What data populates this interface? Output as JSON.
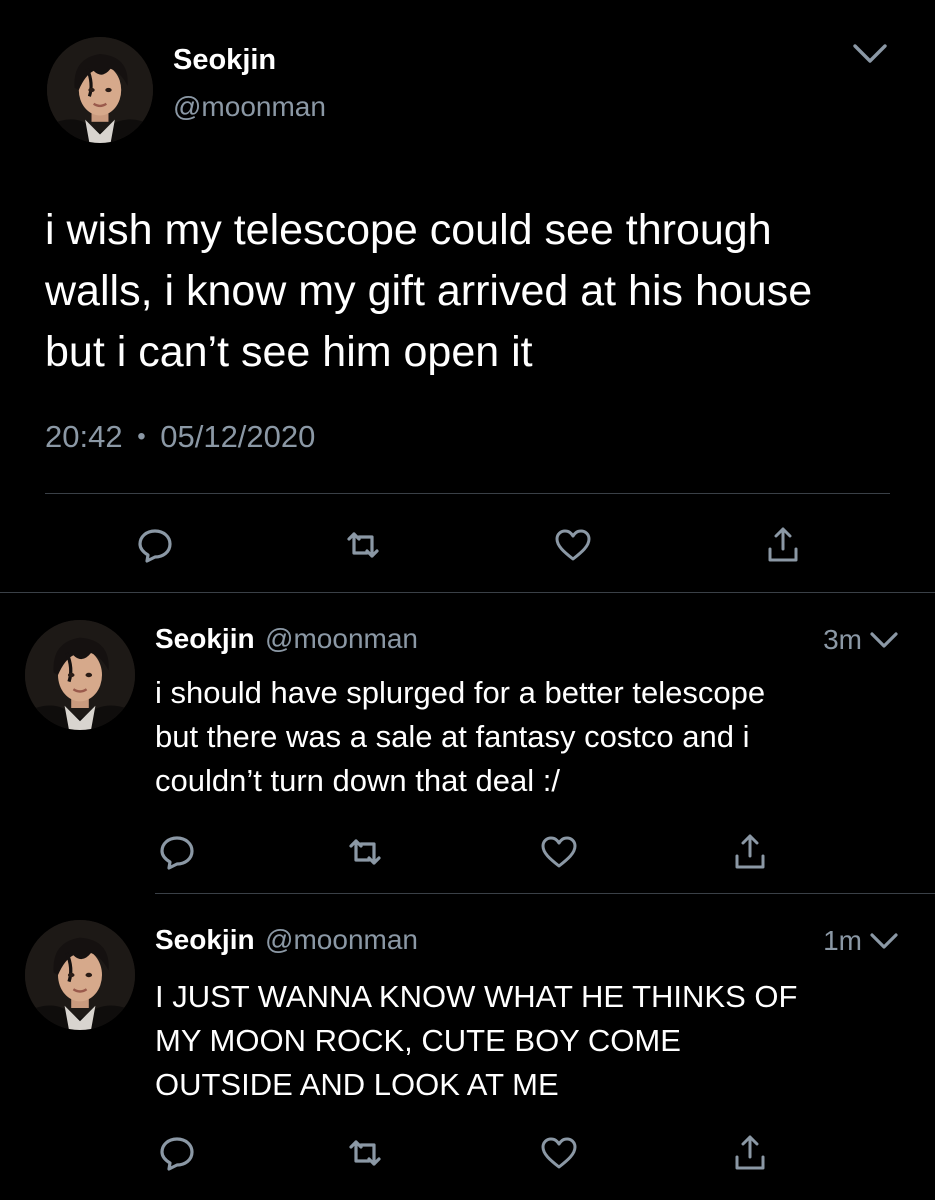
{
  "main_tweet": {
    "display_name": "Seokjin",
    "handle": "@moonman",
    "text_lines": [
      "i wish my telescope could see through",
      "walls, i know my gift arrived at his house",
      "but i can’t see him open it"
    ],
    "time": "20:42",
    "separator": "•",
    "date": "05/12/2020"
  },
  "replies": [
    {
      "display_name": "Seokjin",
      "handle": "@moonman",
      "age": "3m",
      "text_lines": [
        "i should have splurged for a better telescope",
        "but there was a sale at fantasy costco and i",
        "couldn’t turn down that deal :/"
      ]
    },
    {
      "display_name": "Seokjin",
      "handle": "@moonman",
      "age": "1m",
      "text_lines": [
        "I JUST WANNA KNOW WHAT HE THINKS OF",
        "MY MOON ROCK, CUTE BOY COME",
        "OUTSIDE AND LOOK AT ME"
      ]
    }
  ],
  "icons": {
    "reply": "reply-icon",
    "retweet": "retweet-icon",
    "like": "heart-icon",
    "share": "share-icon",
    "more": "chevron-down-icon"
  },
  "colors": {
    "background": "#000000",
    "text": "#ffffff",
    "muted": "#8b98a5",
    "divider": "#3a4047"
  }
}
